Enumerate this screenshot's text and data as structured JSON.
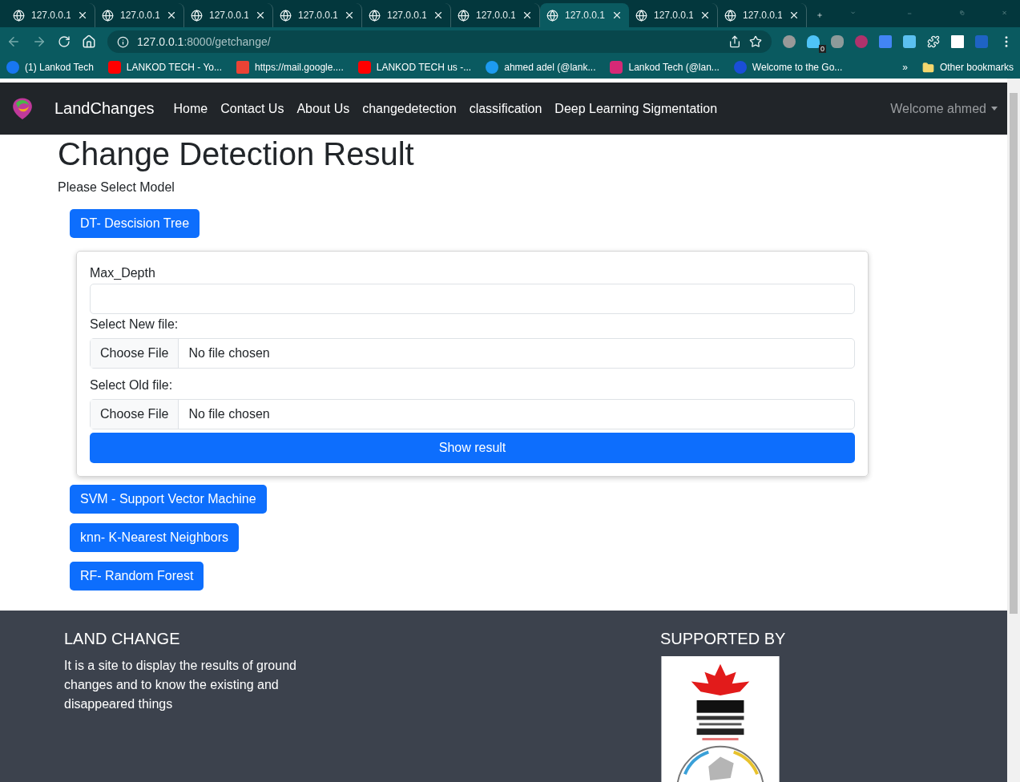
{
  "browser": {
    "tabs": [
      {
        "title": "127.0.0.1",
        "selected": false
      },
      {
        "title": "127.0.0.1",
        "selected": false
      },
      {
        "title": "127.0.0.1",
        "selected": false
      },
      {
        "title": "127.0.0.1",
        "selected": false
      },
      {
        "title": "127.0.0.1",
        "selected": false
      },
      {
        "title": "127.0.0.1",
        "selected": false
      },
      {
        "title": "127.0.0.1",
        "selected": true
      },
      {
        "title": "127.0.0.1",
        "selected": false
      },
      {
        "title": "127.0.0.1",
        "selected": false
      }
    ],
    "address": {
      "host": "127.0.0.1",
      "path": ":8000/getchange/"
    },
    "extension_badge": "0",
    "bookmarks": [
      {
        "label": "(1) Lankod Tech",
        "kind": "facebook"
      },
      {
        "label": "LANKOD TECH - Yo...",
        "kind": "youtube"
      },
      {
        "label": "https://mail.google....",
        "kind": "gmail"
      },
      {
        "label": "LANKOD TECH us -...",
        "kind": "youtube"
      },
      {
        "label": "ahmed adel (@lank...",
        "kind": "twitter"
      },
      {
        "label": "Lankod Tech (@lan...",
        "kind": "instagram"
      },
      {
        "label": "Welcome to the Go...",
        "kind": "c"
      }
    ],
    "more_bookmarks": "»",
    "other_bookmarks": "Other bookmarks"
  },
  "navbar": {
    "brand": "LandChanges",
    "links": [
      "Home",
      "Contact Us",
      "About Us",
      "changedetection",
      "classification",
      "Deep Learning Sigmentation"
    ],
    "user": "Welcome ahmed"
  },
  "heading": "Change Detection Result",
  "prompt": "Please Select Model",
  "models": [
    {
      "label": "DT- Descision Tree",
      "form": {
        "fields": [
          {
            "kind": "text",
            "label": "Max_Depth"
          },
          {
            "kind": "file",
            "label": "Select New file:",
            "button": "Choose File",
            "status": "No file chosen"
          },
          {
            "kind": "file",
            "label": "Select Old file:",
            "button": "Choose File",
            "status": "No file chosen"
          }
        ],
        "submit": "Show result"
      }
    },
    {
      "label": "SVM - Support Vector Machine"
    },
    {
      "label": "knn- K-Nearest Neighbors"
    },
    {
      "label": "RF- Random Forest"
    }
  ],
  "footer": {
    "title": "LAND CHANGE",
    "text": "It is a site to display the results of ground changes and to know the existing and disappeared things",
    "support_title": "SUPPORTED BY"
  }
}
